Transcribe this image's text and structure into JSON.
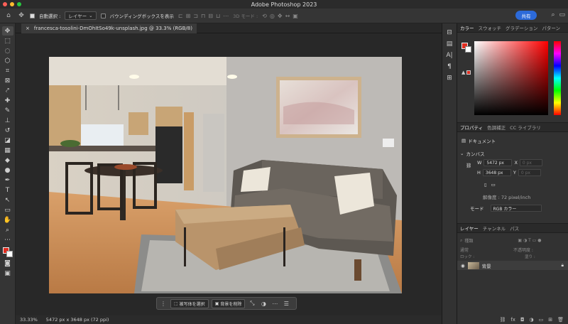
{
  "app": {
    "title": "Adobe Photoshop 2023"
  },
  "options_bar": {
    "auto_select_label": "自動選択 :",
    "layer_select": "レイヤー",
    "bbox_label": "バウンディングボックスを表示",
    "mode_3d": "3D モード :",
    "share_label": "共有"
  },
  "document": {
    "tab_title": "francesca-tosolini-DmOhItSo49k-unsplash.jpg @ 33.3% (RGB/8)"
  },
  "context_bar": {
    "select_subject": "被写体を選択",
    "remove_bg": "背景を削除"
  },
  "status": {
    "zoom": "33.33%",
    "info": "5472 px x 3648 px (72 ppi)"
  },
  "color_panel": {
    "tabs": [
      "カラー",
      "スウォッチ",
      "グラデーション",
      "パターン"
    ],
    "foreground": "#e02d20",
    "background": "#ffffff"
  },
  "properties": {
    "tabs": [
      "プロパティ",
      "色調補正",
      "CC ライブラリ"
    ],
    "doc_label": "ドキュメント",
    "canvas_label": "カンバス",
    "w_label": "W",
    "w_value": "5472 px",
    "x_label": "X",
    "x_value": "0 px",
    "h_label": "H",
    "h_value": "3648 px",
    "y_label": "Y",
    "y_value": "0 px",
    "resolution": "解像度 : 72 pixel/inch",
    "mode_label": "モード",
    "mode_value": "RGB カラー"
  },
  "layers": {
    "tabs": [
      "レイヤー",
      "チャンネル",
      "パス"
    ],
    "search_placeholder": "種類",
    "blend_mode": "通常",
    "opacity_label": "不透明度 :",
    "lock_label": "ロック :",
    "fill_label": "塗り :",
    "layer_name": "背景"
  }
}
